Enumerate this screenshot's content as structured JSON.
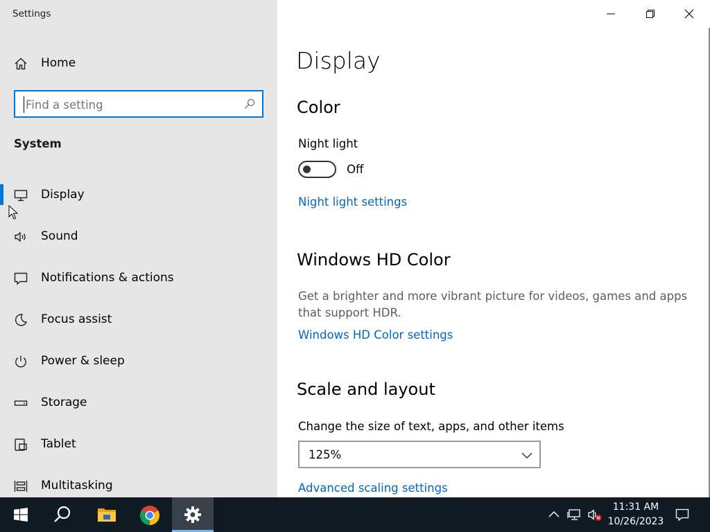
{
  "window": {
    "title": "Settings",
    "minimize_icon": "minimize-icon",
    "maximize_icon": "restore-icon",
    "close_icon": "close-icon"
  },
  "sidebar": {
    "home_label": "Home",
    "search": {
      "placeholder": "Find a setting",
      "value": ""
    },
    "section": "System",
    "items": [
      {
        "label": "Display",
        "icon": "monitor-icon",
        "active": true
      },
      {
        "label": "Sound",
        "icon": "speaker-icon"
      },
      {
        "label": "Notifications & actions",
        "icon": "notification-icon"
      },
      {
        "label": "Focus assist",
        "icon": "moon-icon"
      },
      {
        "label": "Power & sleep",
        "icon": "power-icon"
      },
      {
        "label": "Storage",
        "icon": "storage-icon"
      },
      {
        "label": "Tablet",
        "icon": "tablet-icon"
      },
      {
        "label": "Multitasking",
        "icon": "multitasking-icon"
      }
    ]
  },
  "main": {
    "title": "Display",
    "color": {
      "heading": "Color",
      "night_light_label": "Night light",
      "night_light_state": "Off",
      "night_light_on": false,
      "night_light_link": "Night light settings"
    },
    "hd_color": {
      "heading": "Windows HD Color",
      "description": "Get a brighter and more vibrant picture for videos, games and apps that support HDR.",
      "link": "Windows HD Color settings"
    },
    "scale": {
      "heading": "Scale and layout",
      "label": "Change the size of text, apps, and other items",
      "selected": "125%",
      "link": "Advanced scaling settings"
    }
  },
  "taskbar": {
    "apps": [
      "start-icon",
      "search-icon",
      "file-explorer-icon",
      "chrome-icon",
      "settings-icon"
    ],
    "active_app": "settings-icon",
    "time": "11:31 AM",
    "date": "10/26/2023"
  },
  "colors": {
    "accent": "#0078d7",
    "link": "#0067c0",
    "sidebar_bg": "#e6e6e6",
    "taskbar_bg": "#101b25"
  }
}
